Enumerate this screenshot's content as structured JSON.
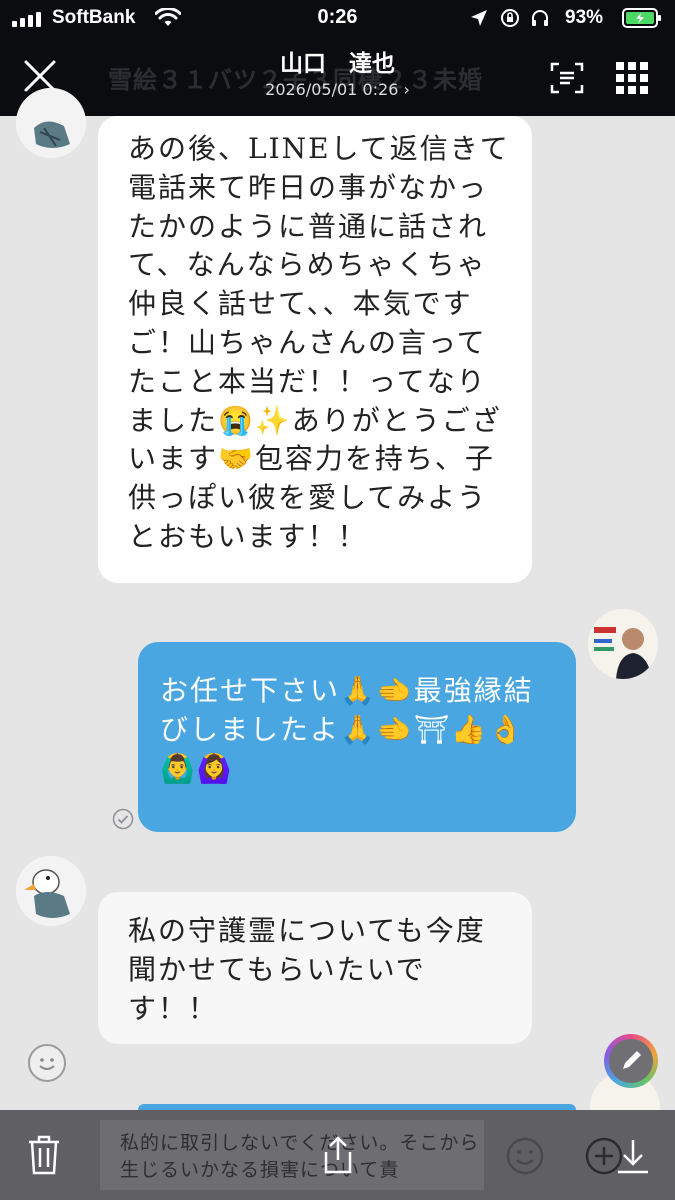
{
  "status_bar": {
    "carrier": "SoftBank",
    "time": "0:26",
    "battery": "93%"
  },
  "header": {
    "contact_name": "山口　達也",
    "background_title": "雪絵３１バツ２子３同棲２３未婚",
    "timestamp": "2026/05/01 0:26 ›",
    "icons": [
      "close-icon",
      "scan-icon",
      "menu-grid-icon"
    ]
  },
  "messages": [
    {
      "direction": "incoming",
      "text": "あの後、LINEして返信きて\n電話来て昨日の事がなかっ\nたかのように普通に話され\nて、なんならめちゃくちゃ\n仲良く話せて、、本気です\nご！山ちゃんさんの言って\nたこと本当だ！！ってなり\nました😭✨ありがとうござ\nいます🤝包容力を持ち、子\n供っぽい彼を愛してみよう\nとおもいます！！"
    },
    {
      "direction": "outgoing",
      "text": "お任せ下さい🙏🫲最強縁結\nびしましたよ🙏🫲⛩👍👌\n🙆‍♂️🙆‍♀️"
    },
    {
      "direction": "incoming",
      "text": "私の守護霊についても今度\n聞かせてもらいたいで\nす！！"
    }
  ],
  "bottom_bar": {
    "disclaimer": "私的に取引しないでください。そこから生じるいかなる損害について責",
    "icons": [
      "trash-icon",
      "share-icon",
      "emoji-icon",
      "add-icon",
      "download-icon"
    ]
  },
  "colors": {
    "header_bg": "#0b0c10",
    "chat_bg": "#e5e5e6",
    "outgoing_bubble": "#4aa6e0",
    "incoming_bubble": "#ffffff"
  }
}
